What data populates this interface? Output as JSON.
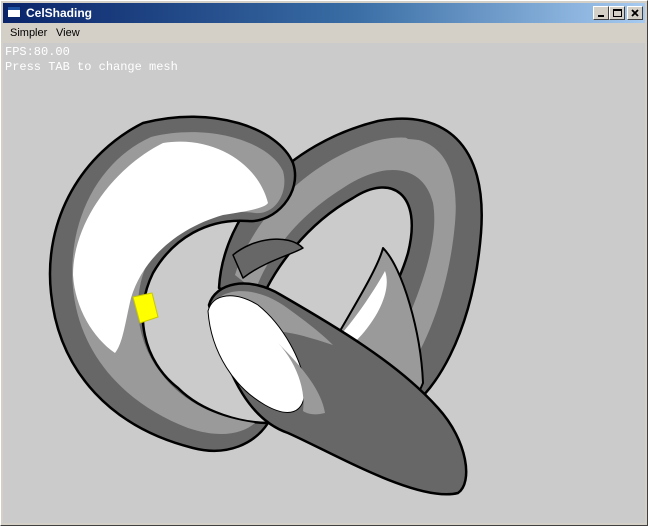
{
  "window": {
    "title": "CelShading"
  },
  "menu": {
    "items": [
      "Simpler",
      "View"
    ]
  },
  "hud": {
    "fps": "FPS:80.00",
    "hint": "Press TAB to change mesh"
  },
  "scene": {
    "mesh": "torus-knot",
    "colors": {
      "background": "#cbcbcb",
      "outline": "#000000",
      "dark": "#676767",
      "mid": "#9a9a9a",
      "highlight": "#ffffff",
      "light": "#ffff00"
    }
  }
}
